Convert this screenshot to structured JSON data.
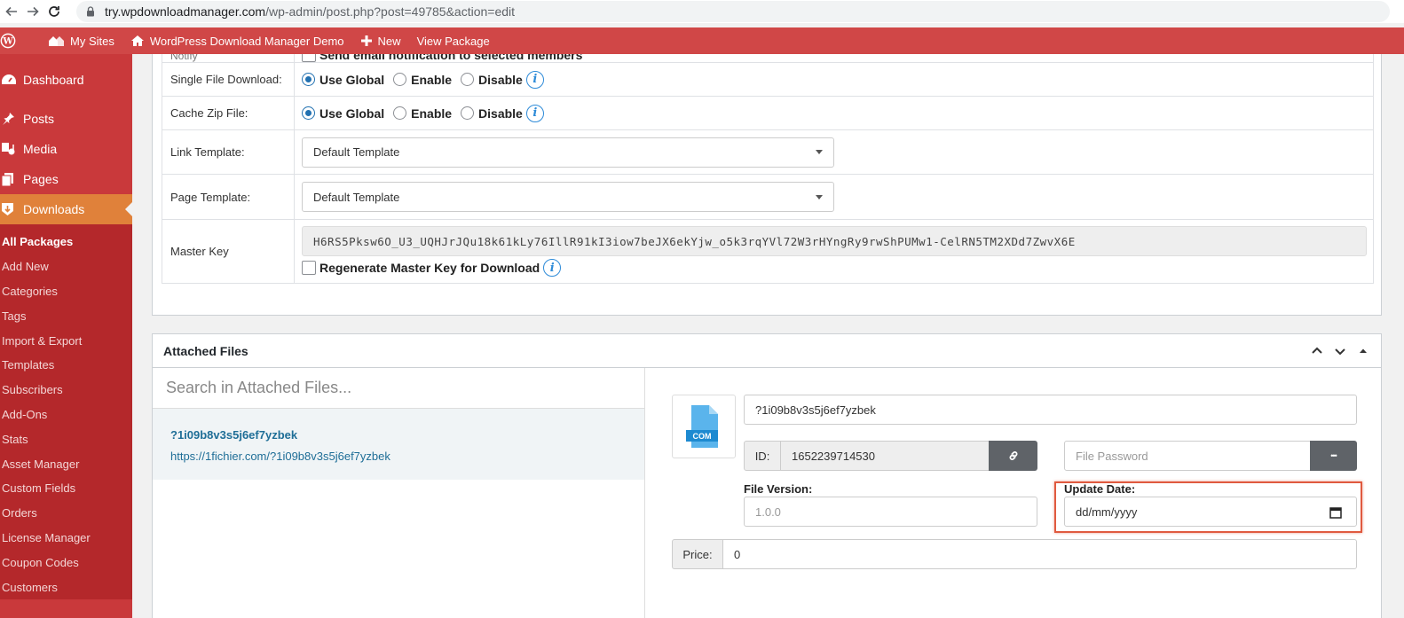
{
  "browser": {
    "url_host": "try.wpdownloadmanager.com",
    "url_path": "/wp-admin/post.php?post=49785&action=edit"
  },
  "adminbar": {
    "my_sites": "My Sites",
    "site_name": "WordPress Download Manager Demo",
    "new": "New",
    "view_package": "View Package"
  },
  "sidebar": {
    "top_items": [
      "Dashboard",
      "Posts",
      "Media",
      "Pages",
      "Downloads"
    ],
    "sub_items": [
      "All Packages",
      "Add New",
      "Categories",
      "Tags",
      "Import & Export",
      "Templates",
      "Subscribers",
      "Add-Ons",
      "Stats",
      "Asset Manager",
      "Custom Fields",
      "Orders",
      "License Manager",
      "Coupon Codes",
      "Customers"
    ]
  },
  "settings": {
    "notify_label": "Notify",
    "notify_checkbox": "Send email notification to selected members",
    "single_file_label": "Single File Download:",
    "cache_zip_label": "Cache Zip File:",
    "radio_use_global": "Use Global",
    "radio_enable": "Enable",
    "radio_disable": "Disable",
    "link_template_label": "Link Template:",
    "link_template_value": "Default Template",
    "page_template_label": "Page Template:",
    "page_template_value": "Default Template",
    "master_key_label": "Master Key",
    "master_key_value": "H6RS5Pksw6O_U3_UQHJrJQu18k61kLy76IllR91kI3iow7beJX6ekYjw_o5k3rqYVl72W3rHYngRy9rwShPUMw1-CelRN5TM2XDd7ZwvX6E",
    "regenerate_label": "Regenerate Master Key for Download"
  },
  "attached_files": {
    "title": "Attached Files",
    "search_placeholder": "Search in Attached Files...",
    "file_name": "?1i09b8v3s5j6ef7yzbek",
    "file_url": "https://1fichier.com/?1i09b8v3s5j6ef7yzbek",
    "file_icon_label": "COM",
    "title_value": "?1i09b8v3s5j6ef7yzbek",
    "id_label": "ID:",
    "id_value": "1652239714530",
    "password_placeholder": "File Password",
    "password_button": "•••",
    "file_version_label": "File Version:",
    "file_version_placeholder": "1.0.0",
    "update_date_label": "Update Date:",
    "update_date_placeholder": "dd/mm/yyyy",
    "price_label": "Price:",
    "price_value": "0"
  },
  "colors": {
    "adminbar": "#d04747",
    "sidebar": "#c9393b",
    "active_menu": "#e0813a",
    "link": "#1f6e97",
    "highlight": "#e05a3f"
  }
}
